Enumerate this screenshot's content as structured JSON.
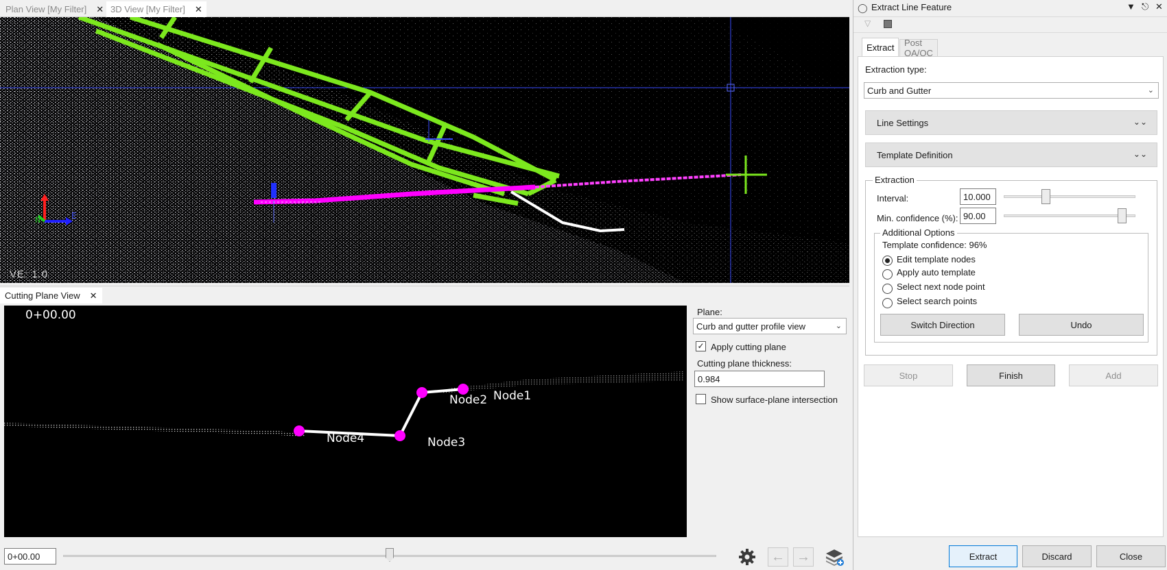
{
  "doc_tabs": [
    {
      "label": "Plan View [My Filter]",
      "close": "✕"
    },
    {
      "label": "3D View [My Filter]",
      "close": "✕"
    }
  ],
  "view3d": {
    "ve_label": "VE: 1.0",
    "axis_e": "E",
    "axis_n": "N"
  },
  "cutting_plane_view": {
    "tab_label": "Cutting Plane View",
    "tab_close": "✕",
    "station_overlay": "0+00.00",
    "nodes": [
      {
        "label": "Node1"
      },
      {
        "label": "Node2"
      },
      {
        "label": "Node3"
      },
      {
        "label": "Node4"
      }
    ],
    "plane_label": "Plane:",
    "plane_value": "Curb and gutter profile view",
    "apply_cutting_plane_label": "Apply cutting plane",
    "apply_cutting_plane_checked": "✓",
    "thickness_label": "Cutting plane thickness:",
    "thickness_value": "0.984",
    "show_intersection_label": "Show surface-plane intersection",
    "station_input": "0+00.00",
    "slider_position": 0.5
  },
  "panel": {
    "title": "Extract Line Feature",
    "tabs": [
      {
        "label": "Extract"
      },
      {
        "label": "Post QA/QC"
      }
    ],
    "extraction_type_label": "Extraction type:",
    "extraction_type_value": "Curb and Gutter",
    "line_settings_label": "Line Settings",
    "template_definition_label": "Template Definition",
    "extraction_group": "Extraction",
    "interval_label": "Interval:",
    "interval_value": "10.000",
    "interval_slider": 0.32,
    "min_confidence_label": "Min. confidence (%):",
    "min_confidence_value": "90.00",
    "min_confidence_slider": 0.9,
    "additional_options_label": "Additional Options",
    "template_confidence": "Template confidence: 96%",
    "options": [
      {
        "label": "Edit template nodes",
        "selected": true
      },
      {
        "label": "Apply auto template",
        "selected": false
      },
      {
        "label": "Select next node point",
        "selected": false
      },
      {
        "label": "Select search points",
        "selected": false
      }
    ],
    "switch_direction": "Switch Direction",
    "undo": "Undo",
    "stop": "Stop",
    "finish": "Finish",
    "add": "Add",
    "extract": "Extract",
    "discard": "Discard",
    "close": "Close"
  }
}
